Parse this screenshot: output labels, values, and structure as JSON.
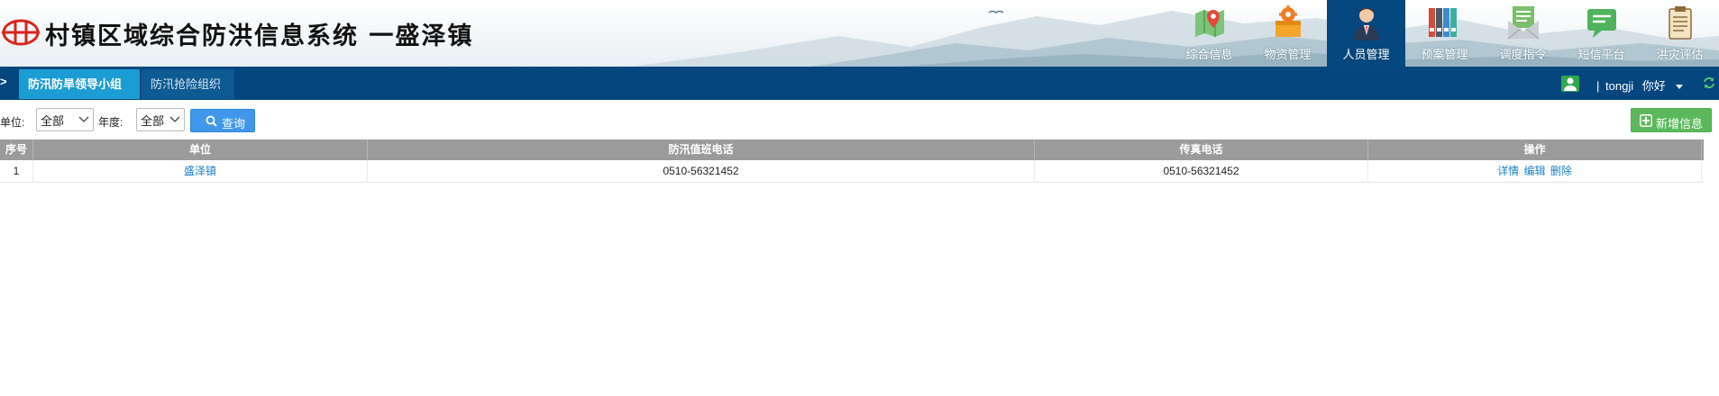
{
  "header": {
    "title": "村镇区域综合防洪信息系统 一盛泽镇",
    "nav": [
      {
        "label": "综合信息",
        "icon": "map-pin-icon",
        "active": false
      },
      {
        "label": "物资管理",
        "icon": "package-gear-icon",
        "active": false
      },
      {
        "label": "人员管理",
        "icon": "person-icon",
        "active": true
      },
      {
        "label": "预案管理",
        "icon": "binders-icon",
        "active": false
      },
      {
        "label": "调度指令",
        "icon": "envelope-icon",
        "active": false
      },
      {
        "label": "短信平台",
        "icon": "chat-bubble-icon",
        "active": false
      },
      {
        "label": "洪灾评估",
        "icon": "clipboard-icon",
        "active": false
      }
    ]
  },
  "tabbar": {
    "arrow": ">",
    "tabs": [
      {
        "label": "防汛防旱领导小组",
        "active": true
      },
      {
        "label": "防汛抢险组织",
        "active": false
      }
    ],
    "user": {
      "separator": "|",
      "name": "tongji",
      "greeting": "你好"
    }
  },
  "filters": {
    "unit_label": "单位:",
    "unit_value": "全部",
    "year_label": "年度:",
    "year_value": "全部",
    "query_label": "查询",
    "add_label": "新增信息"
  },
  "table": {
    "columns": [
      "序号",
      "单位",
      "防汛值班电话",
      "传真电话",
      "操作"
    ],
    "rows": [
      {
        "index": "1",
        "unit": "盛泽镇",
        "duty_phone": "0510-56321452",
        "fax": "0510-56321452",
        "actions": [
          "详情",
          "编辑",
          "删除"
        ]
      }
    ]
  },
  "colors": {
    "nav_active": "#05477f",
    "tabbar": "#05467e",
    "tab_active": "#1b9cd3",
    "query_button": "#4197e9",
    "add_button": "#5cb85c",
    "table_header": "#9b9b9b",
    "link": "#1a7fc9"
  }
}
